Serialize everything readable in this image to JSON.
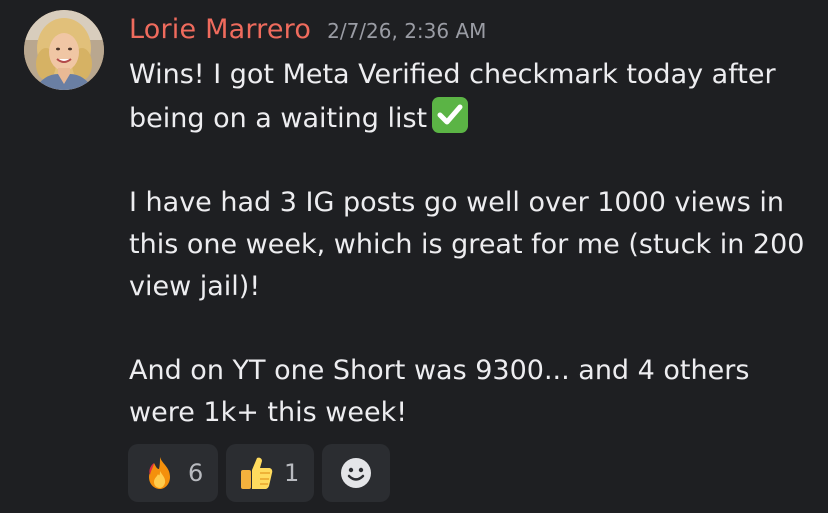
{
  "message": {
    "author": "Lorie Marrero",
    "timestamp": "2/7/26, 2:36 AM",
    "paragraphs": [
      "Wins! I got Meta Verified checkmark today after being on a waiting list",
      "I have had 3 IG posts go well over 1000 views in this one week, which is great for me (stuck in 200 view jail)!",
      "And on YT one Short was 9300...  and 4 others were 1k+ this week!"
    ],
    "inline_emoji": "white-check-mark-icon",
    "author_color": "#ef6b5d"
  },
  "reactions": [
    {
      "emoji": "fire-icon",
      "count": "6"
    },
    {
      "emoji": "thumbs-up-icon",
      "count": "1"
    }
  ],
  "add_reaction": {
    "icon": "smiley-add-reaction-icon"
  }
}
